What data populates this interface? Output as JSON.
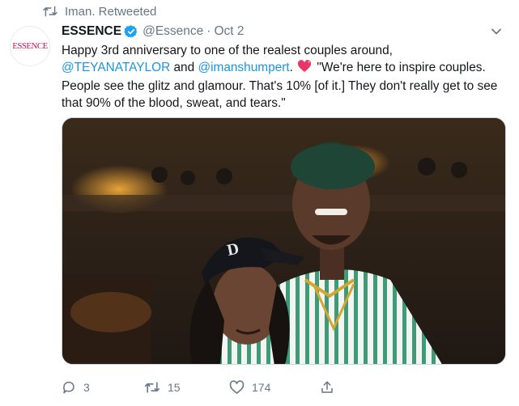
{
  "social_context": {
    "text": "Iman. Retweeted"
  },
  "author": {
    "avatar_text": "ESSENCE",
    "display_name": "ESSENCE",
    "handle": "@Essence",
    "separator": "·",
    "timestamp": "Oct 2"
  },
  "tweet": {
    "text_1": "Happy 3rd anniversary to one of the realest couples around, ",
    "mention_1": "@TEYANATAYLOR",
    "text_2": " and ",
    "mention_2": "@imanshumpert",
    "text_3": ". ",
    "text_4": " \"We're here to inspire couples. People see the glitz and glamour. That's 10% [of it.] They don't really get to see that 90% of the blood, sweat, and tears.\""
  },
  "stats": {
    "replies": "3",
    "retweets": "15",
    "likes": "174"
  },
  "colors": {
    "accent": "#1b95e0",
    "muted": "#657786",
    "brand": "#c2185b"
  },
  "icons": {
    "retweet": "retweet-icon",
    "verified": "verified-badge-icon",
    "more": "chevron-down-icon",
    "reply": "reply-icon",
    "like": "heart-icon",
    "share": "share-icon",
    "emoji": "heart-with-sparkles-emoji"
  }
}
